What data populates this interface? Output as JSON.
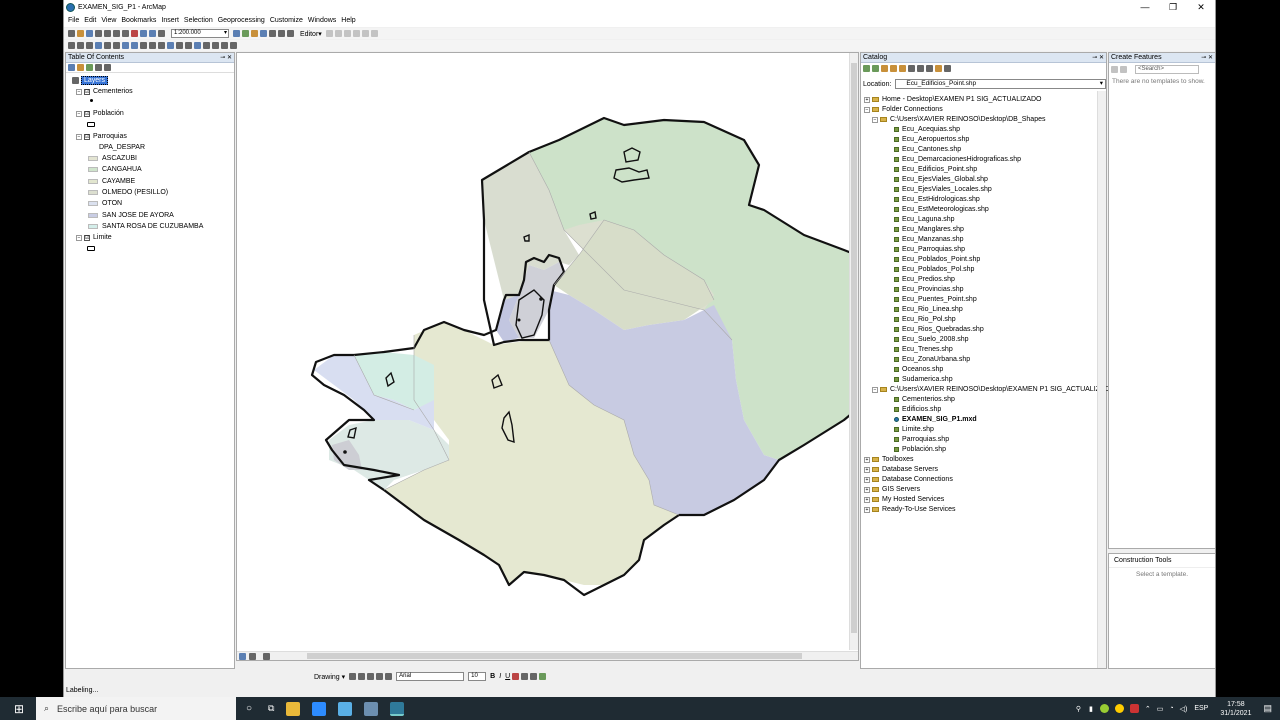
{
  "window": {
    "title": "EXAMEN_SIG_P1 - ArcMap",
    "min": "—",
    "max": "❐",
    "close": "✕"
  },
  "menu": [
    "File",
    "Edit",
    "View",
    "Bookmarks",
    "Insert",
    "Selection",
    "Geoprocessing",
    "Customize",
    "Windows",
    "Help"
  ],
  "toolbar": {
    "scale": "1:200.000",
    "editor": "Editor▾"
  },
  "toc": {
    "title": "Table Of Contents",
    "root": "Layers",
    "layers": [
      {
        "name": "Cementerios",
        "checked": "☑"
      },
      {
        "name": "Población",
        "checked": "☑"
      },
      {
        "name": "Parroquias",
        "checked": "☑"
      },
      {
        "name": "Limite",
        "checked": "☑"
      }
    ],
    "parroquias_field": "DPA_DESPAR",
    "parroquias_values": [
      {
        "label": "ASCAZUBI",
        "color": "#e3e4d2"
      },
      {
        "label": "CANGAHUA",
        "color": "#cfe4cc"
      },
      {
        "label": "CAYAMBE",
        "color": "#e2e6cf"
      },
      {
        "label": "OLMEDO (PESILLO)",
        "color": "#dcdfd0"
      },
      {
        "label": "OTON",
        "color": "#dbe1ef"
      },
      {
        "label": "SAN JOSE DE AYORA",
        "color": "#c9cde4"
      },
      {
        "label": "SANTA ROSA DE CUZUBAMBA",
        "color": "#d4eeea"
      }
    ]
  },
  "catalog": {
    "title": "Catalog",
    "location_label": "Location:",
    "location_value": "Ecu_Edificios_Point.shp",
    "items": [
      {
        "label": "Home - Desktop\\EXAMEN P1 SIG_ACTUALIZADO",
        "indent": 0,
        "type": "folder",
        "exp": "+"
      },
      {
        "label": "Folder Connections",
        "indent": 0,
        "type": "folder",
        "exp": "−"
      },
      {
        "label": "C:\\Users\\XAVIER REINOSO\\Desktop\\DB_Shapes",
        "indent": 1,
        "type": "folder",
        "exp": "−"
      },
      {
        "label": "Ecu_Acequias.shp",
        "indent": 2,
        "type": "shp"
      },
      {
        "label": "Ecu_Aeropuertos.shp",
        "indent": 2,
        "type": "shp"
      },
      {
        "label": "Ecu_Cantones.shp",
        "indent": 2,
        "type": "shp"
      },
      {
        "label": "Ecu_DemarcacionesHidrograficas.shp",
        "indent": 2,
        "type": "shp"
      },
      {
        "label": "Ecu_Edificios_Point.shp",
        "indent": 2,
        "type": "shp"
      },
      {
        "label": "Ecu_EjesViales_Global.shp",
        "indent": 2,
        "type": "shp"
      },
      {
        "label": "Ecu_EjesViales_Locales.shp",
        "indent": 2,
        "type": "shp"
      },
      {
        "label": "Ecu_EstHidrologicas.shp",
        "indent": 2,
        "type": "shp"
      },
      {
        "label": "Ecu_EstMeteorologicas.shp",
        "indent": 2,
        "type": "shp"
      },
      {
        "label": "Ecu_Laguna.shp",
        "indent": 2,
        "type": "shp"
      },
      {
        "label": "Ecu_Manglares.shp",
        "indent": 2,
        "type": "shp"
      },
      {
        "label": "Ecu_Manzanas.shp",
        "indent": 2,
        "type": "shp"
      },
      {
        "label": "Ecu_Parroquias.shp",
        "indent": 2,
        "type": "shp"
      },
      {
        "label": "Ecu_Poblados_Point.shp",
        "indent": 2,
        "type": "shp"
      },
      {
        "label": "Ecu_Poblados_Pol.shp",
        "indent": 2,
        "type": "shp"
      },
      {
        "label": "Ecu_Predios.shp",
        "indent": 2,
        "type": "shp"
      },
      {
        "label": "Ecu_Provincias.shp",
        "indent": 2,
        "type": "shp"
      },
      {
        "label": "Ecu_Puentes_Point.shp",
        "indent": 2,
        "type": "shp"
      },
      {
        "label": "Ecu_Rio_Linea.shp",
        "indent": 2,
        "type": "shp"
      },
      {
        "label": "Ecu_Rio_Pol.shp",
        "indent": 2,
        "type": "shp"
      },
      {
        "label": "Ecu_Rios_Quebradas.shp",
        "indent": 2,
        "type": "shp"
      },
      {
        "label": "Ecu_Suelo_2008.shp",
        "indent": 2,
        "type": "shp"
      },
      {
        "label": "Ecu_Trenes.shp",
        "indent": 2,
        "type": "shp"
      },
      {
        "label": "Ecu_ZonaUrbana.shp",
        "indent": 2,
        "type": "shp"
      },
      {
        "label": "Oceanos.shp",
        "indent": 2,
        "type": "shp"
      },
      {
        "label": "Sudamerica.shp",
        "indent": 2,
        "type": "shp"
      },
      {
        "label": "C:\\Users\\XAVIER REINOSO\\Desktop\\EXAMEN P1 SIG_ACTUALIZADO",
        "indent": 1,
        "type": "folder",
        "exp": "−"
      },
      {
        "label": "Cementerios.shp",
        "indent": 2,
        "type": "shp"
      },
      {
        "label": "Edificios.shp",
        "indent": 2,
        "type": "shp"
      },
      {
        "label": "EXAMEN_SIG_P1.mxd",
        "indent": 2,
        "type": "mxd"
      },
      {
        "label": "Limite.shp",
        "indent": 2,
        "type": "shp"
      },
      {
        "label": "Parroquias.shp",
        "indent": 2,
        "type": "shp"
      },
      {
        "label": "Población.shp",
        "indent": 2,
        "type": "shp"
      },
      {
        "label": "Toolboxes",
        "indent": 0,
        "type": "folder",
        "exp": "+"
      },
      {
        "label": "Database Servers",
        "indent": 0,
        "type": "folder",
        "exp": "+"
      },
      {
        "label": "Database Connections",
        "indent": 0,
        "type": "folder",
        "exp": "+"
      },
      {
        "label": "GIS Servers",
        "indent": 0,
        "type": "folder",
        "exp": "+"
      },
      {
        "label": "My Hosted Services",
        "indent": 0,
        "type": "folder",
        "exp": "+"
      },
      {
        "label": "Ready-To-Use Services",
        "indent": 0,
        "type": "folder",
        "exp": "+"
      }
    ]
  },
  "create_features": {
    "title": "Create Features",
    "search_placeholder": "<Search>",
    "empty": "There are no templates to show."
  },
  "construction": {
    "title": "Construction Tools",
    "empty": "Select a template."
  },
  "drawing": {
    "label": "Drawing ▾",
    "font": "Arial",
    "size": "10"
  },
  "status": "Labeling...",
  "taskbar": {
    "search": "Escribe aquí para buscar",
    "lang": "ESP",
    "time": "17:58",
    "date": "31/1/2021"
  }
}
